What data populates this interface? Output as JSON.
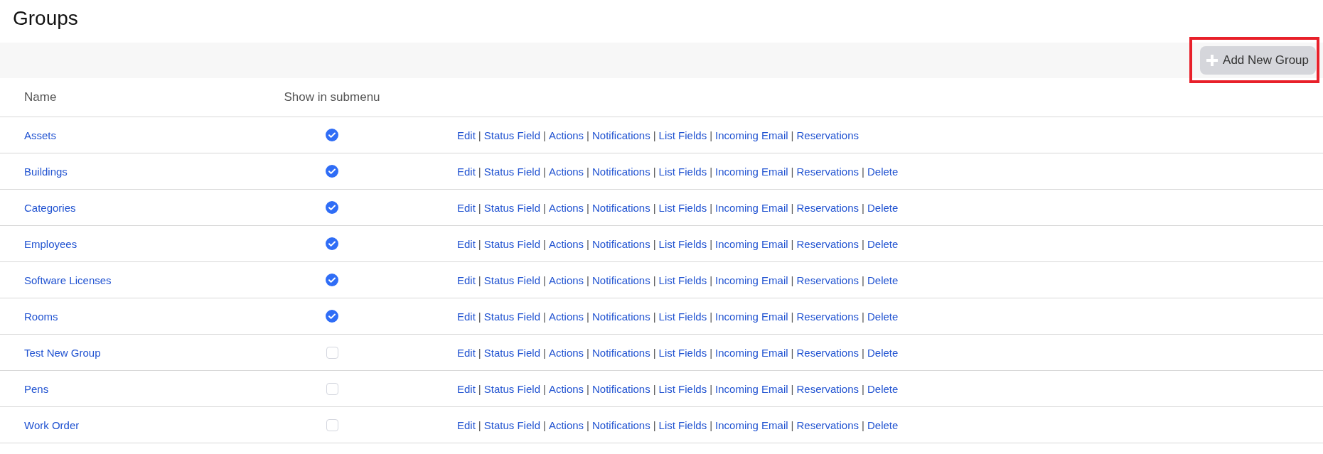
{
  "title": "Groups",
  "toolbar": {
    "add_button": {
      "label": "Add New Group",
      "highlighted": true
    }
  },
  "table": {
    "columns": [
      "Name",
      "Show in submenu"
    ],
    "separator": "|",
    "rows": [
      {
        "name": "Assets",
        "show_in_submenu": true,
        "actions": [
          "Edit",
          "Status Field",
          "Actions",
          "Notifications",
          "List Fields",
          "Incoming Email",
          "Reservations"
        ]
      },
      {
        "name": "Buildings",
        "show_in_submenu": true,
        "actions": [
          "Edit",
          "Status Field",
          "Actions",
          "Notifications",
          "List Fields",
          "Incoming Email",
          "Reservations",
          "Delete"
        ]
      },
      {
        "name": "Categories",
        "show_in_submenu": true,
        "actions": [
          "Edit",
          "Status Field",
          "Actions",
          "Notifications",
          "List Fields",
          "Incoming Email",
          "Reservations",
          "Delete"
        ]
      },
      {
        "name": "Employees",
        "show_in_submenu": true,
        "actions": [
          "Edit",
          "Status Field",
          "Actions",
          "Notifications",
          "List Fields",
          "Incoming Email",
          "Reservations",
          "Delete"
        ]
      },
      {
        "name": "Software Licenses",
        "show_in_submenu": true,
        "actions": [
          "Edit",
          "Status Field",
          "Actions",
          "Notifications",
          "List Fields",
          "Incoming Email",
          "Reservations",
          "Delete"
        ]
      },
      {
        "name": "Rooms",
        "show_in_submenu": true,
        "actions": [
          "Edit",
          "Status Field",
          "Actions",
          "Notifications",
          "List Fields",
          "Incoming Email",
          "Reservations",
          "Delete"
        ]
      },
      {
        "name": "Test New Group",
        "show_in_submenu": false,
        "actions": [
          "Edit",
          "Status Field",
          "Actions",
          "Notifications",
          "List Fields",
          "Incoming Email",
          "Reservations",
          "Delete"
        ]
      },
      {
        "name": "Pens",
        "show_in_submenu": false,
        "actions": [
          "Edit",
          "Status Field",
          "Actions",
          "Notifications",
          "List Fields",
          "Incoming Email",
          "Reservations",
          "Delete"
        ]
      },
      {
        "name": "Work Order",
        "show_in_submenu": false,
        "actions": [
          "Edit",
          "Status Field",
          "Actions",
          "Notifications",
          "List Fields",
          "Incoming Email",
          "Reservations",
          "Delete"
        ]
      }
    ]
  }
}
